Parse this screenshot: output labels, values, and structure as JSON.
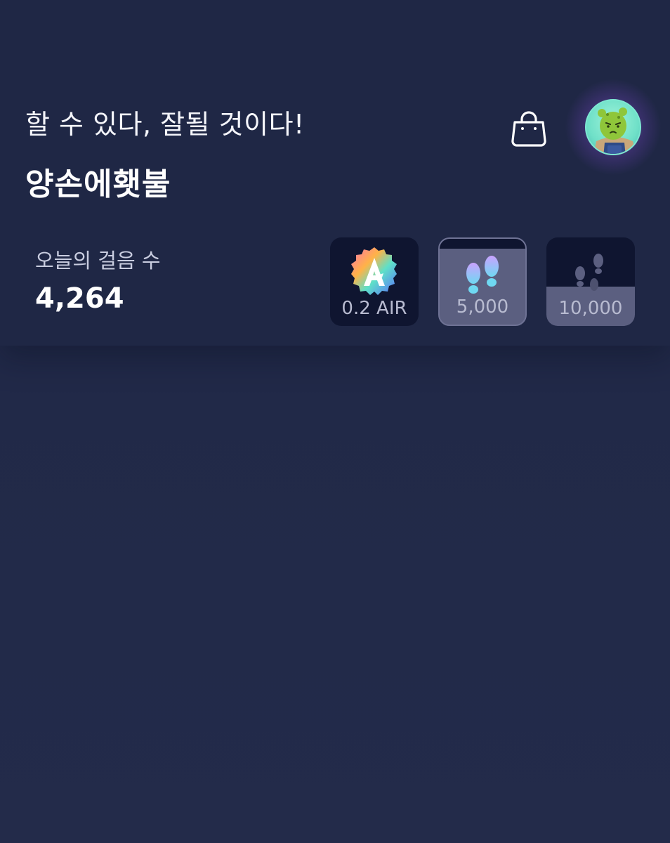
{
  "header": {
    "greeting": "할 수 있다, 잘될 것이다!",
    "username": "양손에횃불",
    "shop_icon": "shopping-bag-icon",
    "avatar_icon": "character-avatar"
  },
  "steps": {
    "label": "오늘의 걸음 수",
    "value": "4,264"
  },
  "rewards": [
    {
      "label": "0.2 AIR",
      "icon": "air-token-icon",
      "state": "locked"
    },
    {
      "label": "5,000",
      "icon": "footprints-icon",
      "state": "highlighted"
    },
    {
      "label": "10,000",
      "icon": "footprints-icon",
      "state": "locked"
    }
  ],
  "colors": {
    "background": "#222a48",
    "header_panel": "#1f2745",
    "tile_dark": "#0f1530",
    "tile_fill": "#5b5f80",
    "avatar_glow": "#965ae6"
  }
}
